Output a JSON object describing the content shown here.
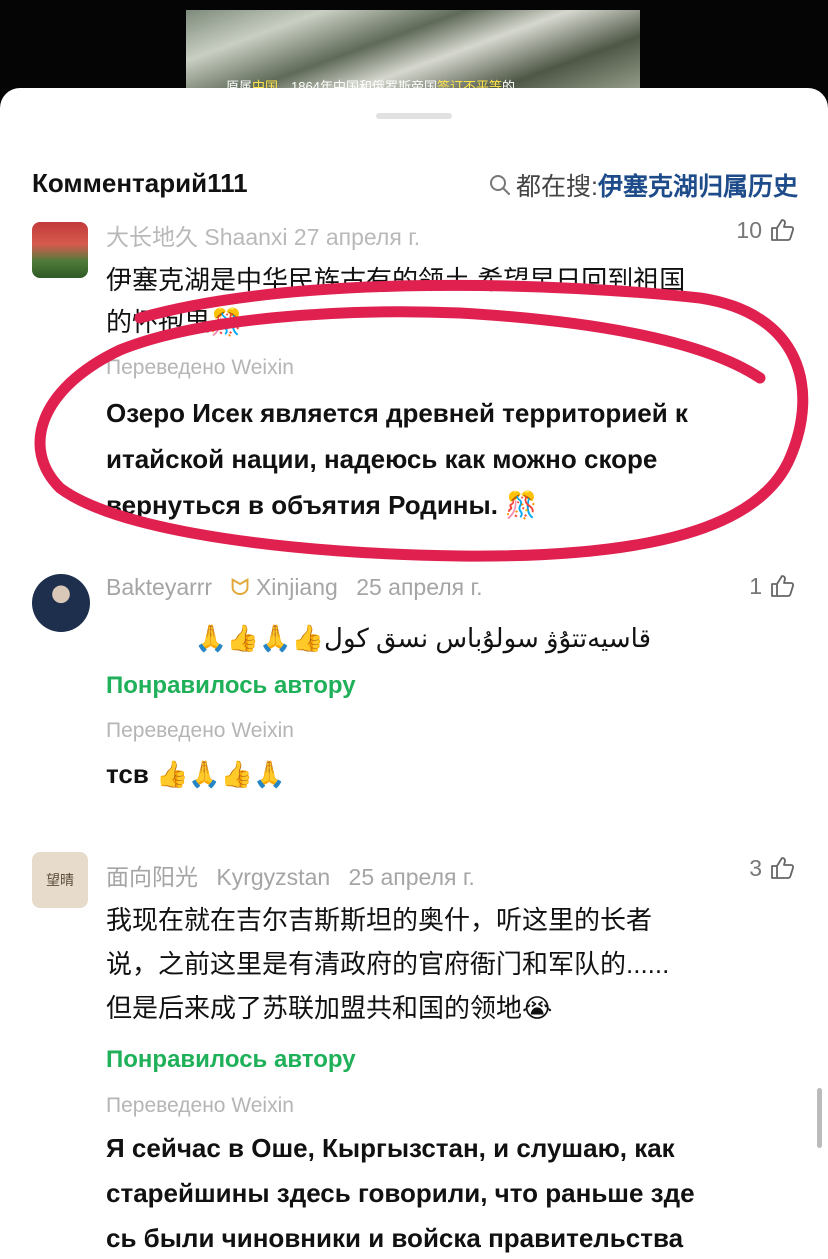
{
  "video": {
    "caption_parts": [
      "原属",
      "中国",
      "，1864年中国和俄罗斯帝国",
      "签订不平等",
      "的"
    ]
  },
  "header": {
    "title": "Комментарий111",
    "search_prefix": "都在搜:",
    "search_term": "伊塞克湖归属历史"
  },
  "comments": [
    {
      "meta": "大长地久 Shaanxi 27 апреля г.",
      "likes": "10",
      "original_line1": "伊塞克湖是中华民族古有的领土  希望早日回到祖国",
      "original_line2": "的怀抱里🎊",
      "translated_label": "Переведено Weixin",
      "translated_line1": "Озеро Исек является древней территорией к",
      "translated_line2": "итайской нации, надеюсь как можно скоре",
      "translated_line3": "вернуться в объятия Родины. 🎊"
    },
    {
      "username": "Bakteyarrr",
      "location": "Xinjiang",
      "date": "25 апреля г.",
      "likes": "1",
      "original": "قاسيەتتۇۋ سولۇباس نسق كول👍🙏👍🙏",
      "liked_by_author": "Понравилось автору",
      "translated_label": "Переведено Weixin",
      "translated": "тсв 👍🙏👍🙏"
    },
    {
      "username": "面向阳光",
      "location": "Kyrgyzstan",
      "date": "25 апреля г.",
      "likes": "3",
      "original_line1": "我现在就在吉尔吉斯斯坦的奥什，听这里的长者",
      "original_line2": "说，之前这里是有清政府的官府衙门和军队的......",
      "original_line3": "但是后来成了苏联加盟共和国的领地😭",
      "liked_by_author": "Понравилось автору",
      "translated_label": "Переведено Weixin",
      "translated_line1": "Я сейчас в Оше, Кыргызстан, и слушаю, как",
      "translated_line2": "старейшины здесь говорили, что раньше зде",
      "translated_line3": "сь были чиновники и войска правительства"
    }
  ],
  "colors": {
    "accent_green": "#1fb05a",
    "search_term_blue": "#1e4c8a",
    "annotation_red": "#e0214f"
  },
  "icons": [
    "search-icon",
    "thumbs-up-icon",
    "bow-icon"
  ]
}
